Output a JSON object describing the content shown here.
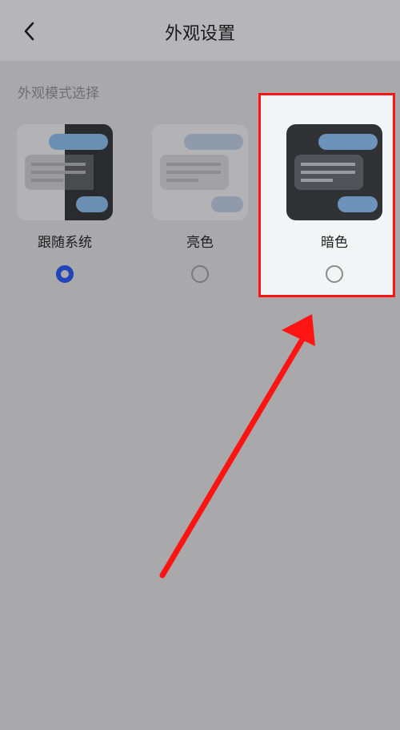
{
  "header": {
    "title": "外观设置",
    "back_icon": "chevron-left-icon"
  },
  "section": {
    "label": "外观模式选择"
  },
  "options": [
    {
      "label": "跟随系统",
      "selected": true
    },
    {
      "label": "亮色",
      "selected": false
    },
    {
      "label": "暗色",
      "selected": false
    }
  ],
  "colors": {
    "accent": "#2344b8",
    "annotation": "#ff1414",
    "background": "#a9a9ab"
  }
}
